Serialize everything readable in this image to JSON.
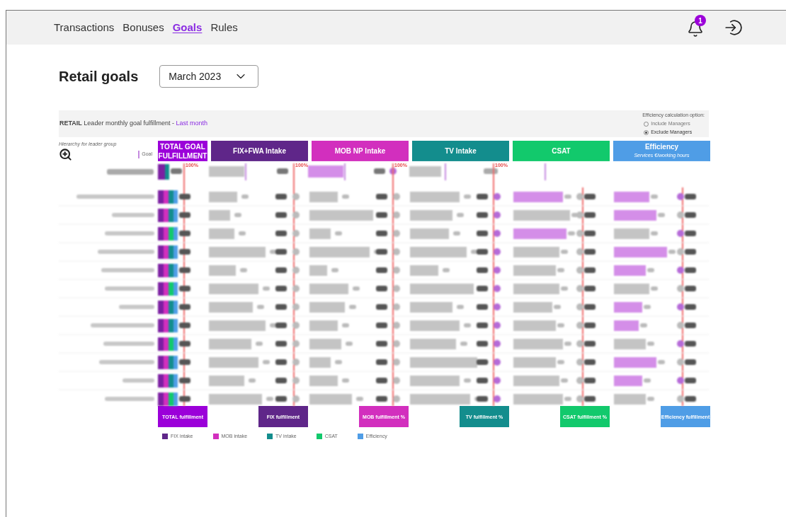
{
  "nav": {
    "tabs": [
      {
        "label": "Transactions",
        "selected": false
      },
      {
        "label": "Bonuses",
        "selected": false
      },
      {
        "label": "Goals",
        "selected": true
      },
      {
        "label": "Rules",
        "selected": false
      }
    ],
    "notification_count": "1"
  },
  "page": {
    "title": "Retail goals",
    "month_select": {
      "value": "March 2023"
    }
  },
  "report": {
    "header": {
      "prefix": "RETAIL",
      "text": "Leader monthly goal fulfillment -",
      "link": "Last month"
    },
    "efficiency_option": {
      "label": "Efficiency calculation option:",
      "options": [
        {
          "label": "Include Managers",
          "selected": false
        },
        {
          "label": "Exclude Managers",
          "selected": true
        }
      ]
    },
    "hierarchy_label": "Hierarchy for leader group",
    "goal_label": "Goal",
    "columns": [
      {
        "title": "TOTAL GOAL FULFILLMENT",
        "color": "#9b00d9"
      },
      {
        "title": "FIX+FWA Intake",
        "color": "#5f2689"
      },
      {
        "title": "MOB NP Intake",
        "color": "#d22fbe"
      },
      {
        "title": "TV Intake",
        "color": "#138d8d"
      },
      {
        "title": "CSAT",
        "color": "#12c96c"
      },
      {
        "title": "Efficiency",
        "subtitle": "Services €/working hours",
        "color": "#4f9de6"
      }
    ],
    "total_row_marks": [
      "100%",
      "100%",
      "100%",
      "100%"
    ],
    "footer": [
      {
        "label": "TOTAL fulfillment",
        "color": "#9b00d9"
      },
      {
        "label": "FIX fulfillment",
        "color": "#5f2689"
      },
      {
        "label": "MOB fulfillment %",
        "color": "#d22fbe"
      },
      {
        "label": "TV fulfillment %",
        "color": "#138d8d"
      },
      {
        "label": "CSAT fulfillment %",
        "color": "#12c96c"
      },
      {
        "label": "Efficiency fulfillment",
        "color": "#4f9de6"
      }
    ],
    "legend": [
      {
        "label": "FIX intake",
        "color": "#5f2689"
      },
      {
        "label": "MOB intake",
        "color": "#d22fbe"
      },
      {
        "label": "TV intake",
        "color": "#138d8d"
      },
      {
        "label": "CSAT",
        "color": "#12c96c"
      },
      {
        "label": "Efficiency",
        "color": "#4f9de6"
      }
    ]
  }
}
